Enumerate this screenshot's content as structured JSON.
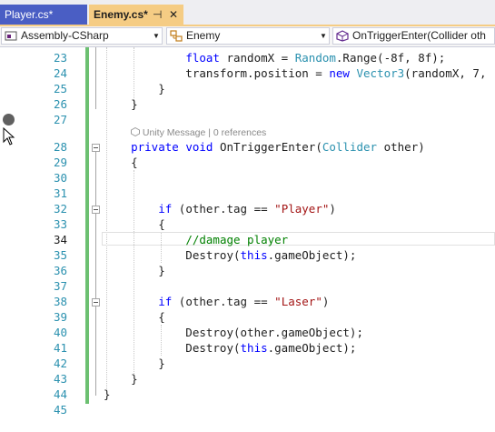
{
  "tabs": [
    {
      "label": "Player.cs*",
      "active": false
    },
    {
      "label": "Enemy.cs*",
      "active": true,
      "pin_glyph": "⊣",
      "close_glyph": "✕"
    }
  ],
  "nav": {
    "project": "Assembly-CSharp",
    "class": "Enemy",
    "member": "OnTriggerEnter(Collider oth"
  },
  "codelens": {
    "icon": "unity-message-icon",
    "text": "Unity Message | 0 references"
  },
  "lines": [
    {
      "num": "23",
      "code": "            float randomX = Random.Range(-8f, 8f);"
    },
    {
      "num": "24",
      "code": "            transform.position = new Vector3(randomX, 7,"
    },
    {
      "num": "25",
      "code": "        }"
    },
    {
      "num": "26",
      "code": "    }"
    },
    {
      "num": "27",
      "code": ""
    },
    {
      "num": "28",
      "code": "    private void OnTriggerEnter(Collider other)"
    },
    {
      "num": "29",
      "code": "    {"
    },
    {
      "num": "30",
      "code": ""
    },
    {
      "num": "31",
      "code": ""
    },
    {
      "num": "32",
      "code": "        if (other.tag == \"Player\")"
    },
    {
      "num": "33",
      "code": "        {"
    },
    {
      "num": "34",
      "code": "            //damage player"
    },
    {
      "num": "35",
      "code": "            Destroy(this.gameObject);"
    },
    {
      "num": "36",
      "code": "        }"
    },
    {
      "num": "37",
      "code": ""
    },
    {
      "num": "38",
      "code": "        if (other.tag == \"Laser\")"
    },
    {
      "num": "39",
      "code": "        {"
    },
    {
      "num": "40",
      "code": "            Destroy(other.gameObject);"
    },
    {
      "num": "41",
      "code": "            Destroy(this.gameObject);"
    },
    {
      "num": "42",
      "code": "        }"
    },
    {
      "num": "43",
      "code": "    }"
    },
    {
      "num": "44",
      "code": "}"
    },
    {
      "num": "45",
      "code": ""
    }
  ],
  "current_line": "34",
  "colors": {
    "keyword": "#0000ff",
    "type": "#2b91af",
    "string": "#a31515",
    "comment": "#008000",
    "line_number": "#2b91af",
    "change_bar": "#6cc071",
    "active_tab": "#f5cc84",
    "inactive_tab": "#4a5ec4"
  }
}
